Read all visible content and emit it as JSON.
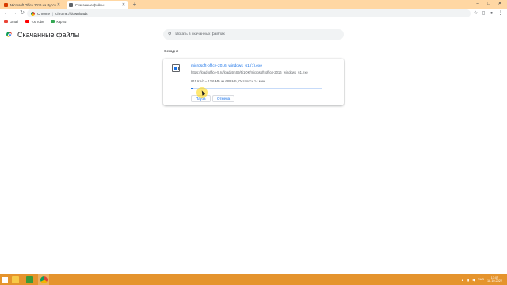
{
  "tabs": [
    {
      "title": "Microsoft Office 2016 на Русско",
      "favicon_color": "#d83b01"
    },
    {
      "title": "Скачанные файлы",
      "favicon_color": "#5f6368"
    }
  ],
  "toolbar": {
    "site_name": "Chrome",
    "separator": "|",
    "url": "chrome://downloads"
  },
  "bookmarks": [
    {
      "label": "Gmail",
      "color": "#ea4335"
    },
    {
      "label": "YouTube",
      "color": "#ff0000"
    },
    {
      "label": "Карты",
      "color": "#34a853"
    }
  ],
  "downloads_page": {
    "title": "Скачанные файлы",
    "search_placeholder": "Искать в скачанных файлах",
    "section_date": "Сегодня",
    "item": {
      "file_name": "microsoft-office-2016_windows_61 (1).exe",
      "url": "https://load-office-5.ru/load/4mS9/5j1OK/microsoft-office-2016_windows_61.exe",
      "status": "815 КБ/с – 12,6 МБ из 689 МБ, Осталось 14 мин.",
      "progress_fraction": 0.018,
      "pause_label": "Пауза",
      "cancel_label": "Отмена"
    }
  },
  "taskbar": {
    "tray_lang": "RUS",
    "time": "13:07",
    "date": "18.10.2022"
  },
  "colors": {
    "tabstrip": "#ffd7a3",
    "accent": "#1a73e8",
    "taskbar": "#e5942d"
  }
}
